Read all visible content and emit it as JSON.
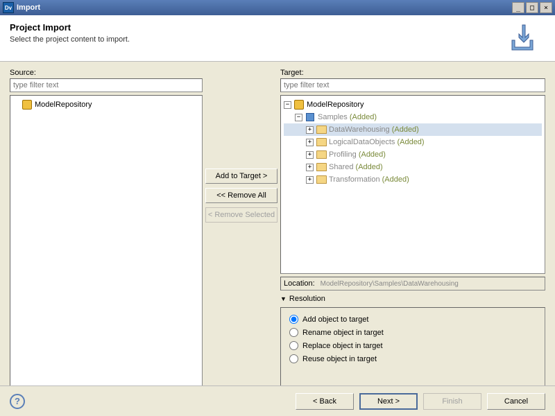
{
  "window": {
    "app_code": "Dv",
    "title": "Import"
  },
  "header": {
    "title": "Project Import",
    "subtitle": "Select the project content to import."
  },
  "source": {
    "label": "Source:",
    "filter_placeholder": "type filter text",
    "root": "ModelRepository"
  },
  "target": {
    "label": "Target:",
    "filter_placeholder": "type filter text",
    "root": "ModelRepository",
    "samples": "Samples",
    "added_suffix": "(Added)",
    "folders": [
      {
        "name": "DataWarehousing"
      },
      {
        "name": "LogicalDataObjects"
      },
      {
        "name": "Profiling"
      },
      {
        "name": "Shared"
      },
      {
        "name": "Transformation"
      }
    ]
  },
  "mid_buttons": {
    "add": "Add to Target >",
    "remove_all": "<< Remove All",
    "remove_sel": "< Remove Selected"
  },
  "location": {
    "label": "Location:",
    "value": "ModelRepository\\Samples\\DataWarehousing"
  },
  "resolution": {
    "header": "Resolution",
    "options": {
      "add": "Add object to target",
      "rename": "Rename object in target",
      "replace": "Replace object in target",
      "reuse": "Reuse object in target"
    },
    "selected": "add"
  },
  "footer": {
    "back": "< Back",
    "next": "Next >",
    "finish": "Finish",
    "cancel": "Cancel"
  }
}
